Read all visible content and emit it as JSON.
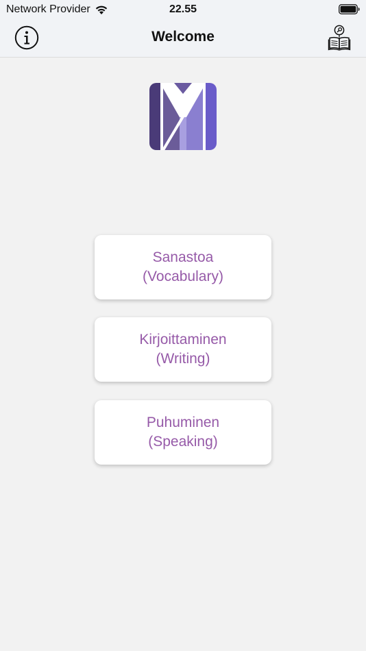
{
  "status": {
    "carrier": "Network Provider",
    "time": "22.55"
  },
  "nav": {
    "title": "Welcome"
  },
  "menu": [
    {
      "line1": "Sanastoa",
      "line2": "(Vocabulary)"
    },
    {
      "line1": "Kirjoittaminen",
      "line2": "(Writing)"
    },
    {
      "line1": "Puhuminen",
      "line2": "(Speaking)"
    }
  ],
  "colors": {
    "accent": "#965aa8",
    "background": "#f2f2f2",
    "bar": "#f1f3f6"
  },
  "icons": {
    "left": "info-icon",
    "right": "book-search-icon"
  }
}
